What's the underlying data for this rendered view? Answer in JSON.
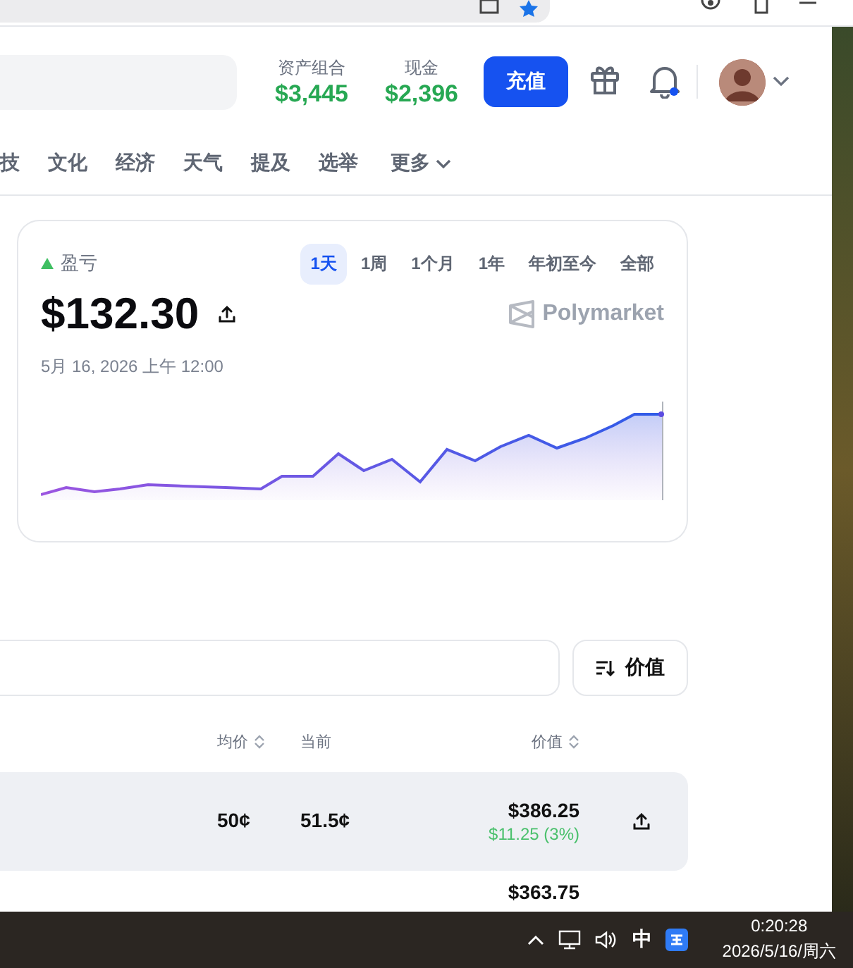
{
  "header": {
    "portfolio": {
      "label": "资产组合",
      "value": "$3,445"
    },
    "cash": {
      "label": "现金",
      "value": "$2,396"
    },
    "deposit_button": "充值",
    "notifications": {
      "unread": true
    }
  },
  "nav": [
    {
      "label": "技"
    },
    {
      "label": "文化"
    },
    {
      "label": "经济"
    },
    {
      "label": "天气"
    },
    {
      "label": "提及"
    },
    {
      "label": "选举"
    }
  ],
  "nav_more": "更多",
  "pnl_card": {
    "label": "盈亏",
    "trend_up": true,
    "amount": "$132.30",
    "brand": "Polymarket",
    "date": "5月 16, 2026 上午 12:00",
    "ranges": [
      {
        "label": "1天",
        "selected": true
      },
      {
        "label": "1周",
        "selected": false
      },
      {
        "label": "1个月",
        "selected": false
      },
      {
        "label": "1年",
        "selected": false
      },
      {
        "label": "年初至今",
        "selected": false
      },
      {
        "label": "全部",
        "selected": false
      }
    ]
  },
  "sort_button": "价值",
  "table": {
    "columns": [
      {
        "label": "均价",
        "sortable": true
      },
      {
        "label": "当前",
        "sortable": false
      },
      {
        "label": "价值",
        "sortable": true
      }
    ],
    "rows": [
      {
        "avg_price": "50¢",
        "current": "51.5¢",
        "value": "$386.25",
        "change": "$11.25 (3%)",
        "highlighted": true
      },
      {
        "value": "$363.75",
        "highlighted": false
      }
    ]
  },
  "taskbar": {
    "ime": "中",
    "time": "0:20:28",
    "date": "2026/5/16/周六"
  }
}
